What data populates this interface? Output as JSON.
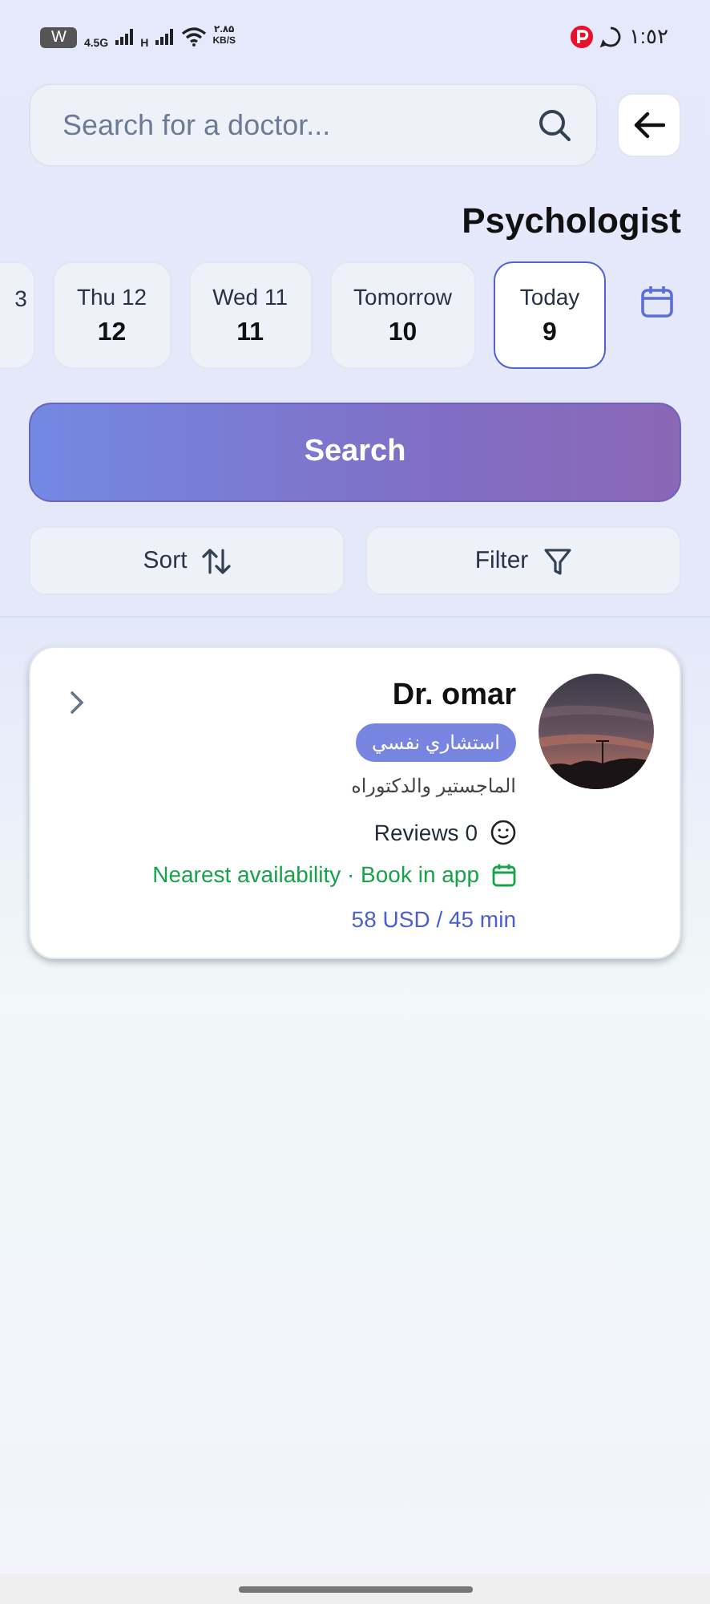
{
  "status_bar": {
    "battery": "W",
    "network_1": "4.5G",
    "network_2": "H",
    "speed_value": "۲.۸۵",
    "speed_unit": "KB/S",
    "time": "١:٥٢"
  },
  "search": {
    "placeholder": "Search for a doctor..."
  },
  "title": "Psychologist",
  "dates": [
    {
      "label": "3",
      "selected": false
    },
    {
      "label": "Thu 12",
      "day": "12",
      "selected": false
    },
    {
      "label": "Wed 11",
      "day": "11",
      "selected": false
    },
    {
      "label": "Tomorrow",
      "day": "10",
      "selected": false
    },
    {
      "label": "Today",
      "day": "9",
      "selected": true
    }
  ],
  "search_button": "Search",
  "sort": "Sort",
  "filter": "Filter",
  "doctors": [
    {
      "name": "Dr. omar",
      "specialty": "استشاري نفسي",
      "degree": "الماجستير والدكتوراه",
      "reviews": "Reviews 0",
      "availability": "Nearest availability · Book in app",
      "price": "58 USD / 45 min"
    }
  ]
}
